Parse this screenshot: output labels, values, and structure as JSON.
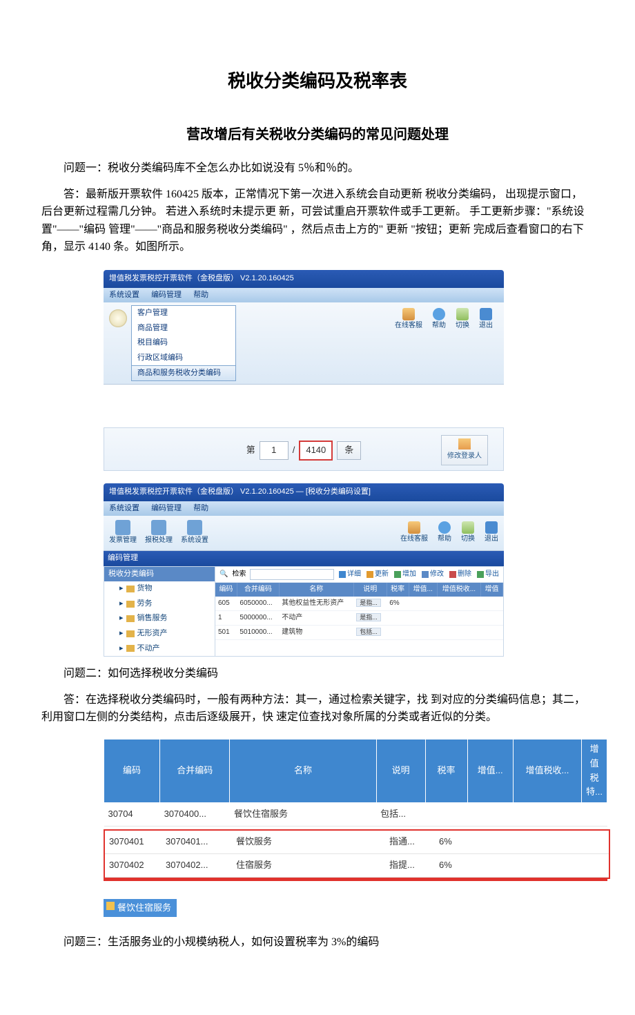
{
  "title": "税收分类编码及税率表",
  "subtitle": "营改增后有关税收分类编码的常见问题处理",
  "q1": "问题一：税收分类编码库不全怎么办比如说没有 5％和％的。",
  "a1": "答：最新版开票软件 160425 版本，正常情况下第一次进入系统会自动更新 税收分类编码， 出现提示窗口， 后台更新过程需几分钟。 若进入系统时未提示更 新，可尝试重启开票软件或手工更新。 手工更新步骤：\"系统设置\"——\"编码 管理\"——\"商品和服务税收分类编码\" ，然后点击上方的\" 更新 \"按钮；更新 完成后查看窗口的右下角，显示 4140 条。如图所示。",
  "screenshot1": {
    "window_title": "增值税发票税控开票软件（金税盘版） V2.1.20.160425",
    "menu": [
      "系统设置",
      "编码管理",
      "帮助"
    ],
    "dropdown": {
      "items": [
        "客户管理",
        "商品管理",
        "税目编码",
        "行政区域编码"
      ],
      "selected": "商品和服务税收分类编码"
    },
    "toolbar_right": [
      {
        "icon": "people",
        "label": "在线客服"
      },
      {
        "icon": "help",
        "label": "帮助"
      },
      {
        "icon": "switch",
        "label": "切换"
      },
      {
        "icon": "arrow",
        "label": "退出"
      }
    ],
    "pager": {
      "label_page": "第",
      "page": "1",
      "sep": "/",
      "total": "4140",
      "unit": "条",
      "change_user": "修改登录人"
    },
    "window2_title": "增值税发票税控开票软件（金税盘版） V2.1.20.160425 — [税收分类编码设置]",
    "menu2": [
      "系统设置",
      "编码管理",
      "帮助"
    ],
    "toolbar2_left": [
      "发票管理",
      "报税处理",
      "系统设置"
    ],
    "toolbar2_right": [
      {
        "icon": "people",
        "label": "在线客服"
      },
      {
        "icon": "help",
        "label": "帮助"
      },
      {
        "icon": "switch",
        "label": "切换"
      },
      {
        "icon": "arrow",
        "label": "退出"
      }
    ],
    "tree_header": "编码管理",
    "tree_root": "税收分类编码",
    "tree_nodes": [
      "货物",
      "劳务",
      "销售服务",
      "无形资产",
      "不动产"
    ],
    "search": {
      "label": "检索",
      "buttons": [
        {
          "label": "详细",
          "color": "#3f87cf"
        },
        {
          "label": "更新",
          "color": "#e29a2e"
        },
        {
          "label": "增加",
          "color": "#4aa05a"
        },
        {
          "label": "修改",
          "color": "#5a89c6"
        },
        {
          "label": "删除",
          "color": "#c94b4b"
        },
        {
          "label": "导出",
          "color": "#4aa05a"
        }
      ]
    },
    "grid": {
      "headers": [
        "编码",
        "合并编码",
        "名称",
        "说明",
        "税率",
        "增值...",
        "增值税收...",
        "增值"
      ],
      "rows": [
        {
          "code": "605",
          "merge": "6050000...",
          "name": "其他权益性无形资产",
          "desc": "是指...",
          "rate": "6%"
        },
        {
          "code": "1",
          "merge": "5000000...",
          "name": "不动产",
          "desc": "是指...",
          "rate": ""
        },
        {
          "code": "501",
          "merge": "5010000...",
          "name": "建筑物",
          "desc": "包括...",
          "rate": ""
        }
      ]
    }
  },
  "q2": "问题二：如何选择税收分类编码",
  "a2": "答：在选择税收分类编码时，一般有两种方法：其一，通过检索关键字，找 到对应的分类编码信息；其二，利用窗口左侧的分类结构，点击后逐级展开，快 速定位查找对象所属的分类或者近似的分类。",
  "table2": {
    "headers": [
      "编码",
      "合并编码",
      "名称",
      "说明",
      "税率",
      "增值...",
      "增值税收...",
      "增值税特..."
    ],
    "rows": [
      {
        "code": "30704",
        "merge": "3070400...",
        "name": "餐饮住宿服务",
        "desc": "包括...",
        "rate": ""
      },
      {
        "code": "3070401",
        "merge": "3070401...",
        "name": "餐饮服务",
        "desc": "指通...",
        "rate": "6%"
      },
      {
        "code": "3070402",
        "merge": "3070402...",
        "name": "住宿服务",
        "desc": "指提...",
        "rate": "6%"
      }
    ]
  },
  "tag_label": "餐饮住宿服务",
  "q3": "问题三：生活服务业的小规模纳税人，如何设置税率为 3%的编码"
}
